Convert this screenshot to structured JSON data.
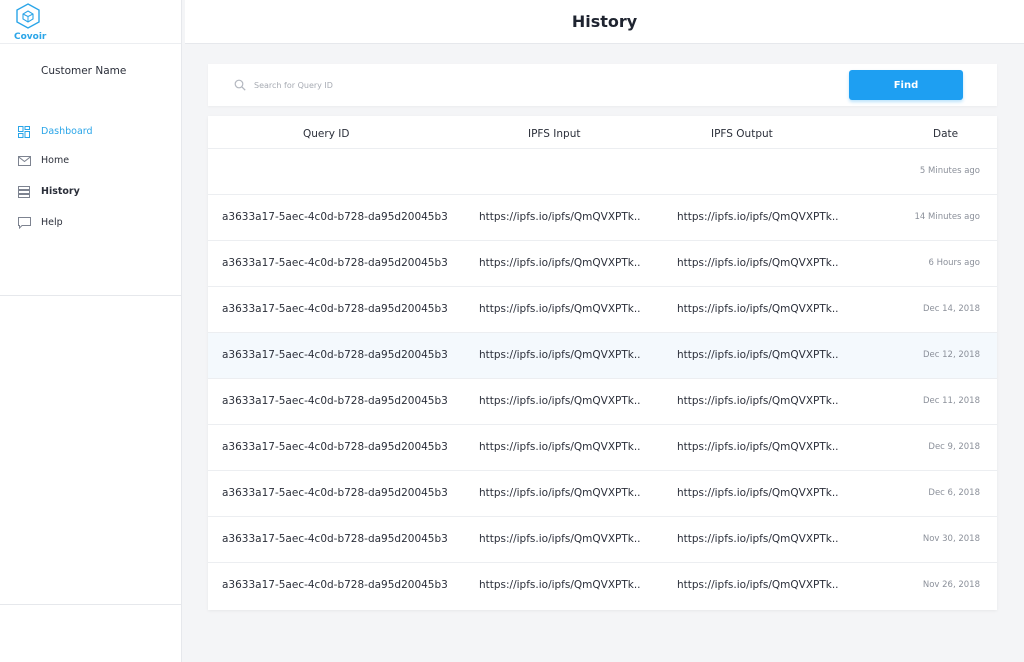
{
  "brand": {
    "name": "Covoir",
    "logo_icon": "cube-hexagon-icon"
  },
  "user": {
    "name": "Customer Name"
  },
  "nav": [
    {
      "label": "Dashboard",
      "icon": "dashboard-grid-icon",
      "active": true
    },
    {
      "label": "Home",
      "icon": "mail-icon",
      "active": false
    },
    {
      "label": "History",
      "icon": "list-icon",
      "active": false
    },
    {
      "label": "Help",
      "icon": "chat-bubble-icon",
      "active": false
    }
  ],
  "header": {
    "title": "History"
  },
  "search": {
    "placeholder": "Search for Query ID",
    "value": "",
    "button_label": "Find"
  },
  "table": {
    "columns": [
      "Query ID",
      "IPFS Input",
      "IPFS Output",
      "Date"
    ],
    "rows": [
      {
        "query_id": "",
        "ipfs_input": "",
        "ipfs_output": "",
        "date": "5 Minutes ago"
      },
      {
        "query_id": "a3633a17-5aec-4c0d-b728-da95d20045b3",
        "ipfs_input": "https://ipfs.io/ipfs/QmQVXPTk..",
        "ipfs_output": "https://ipfs.io/ipfs/QmQVXPTk..",
        "date": "14 Minutes ago"
      },
      {
        "query_id": "a3633a17-5aec-4c0d-b728-da95d20045b3",
        "ipfs_input": "https://ipfs.io/ipfs/QmQVXPTk..",
        "ipfs_output": "https://ipfs.io/ipfs/QmQVXPTk..",
        "date": "6 Hours ago"
      },
      {
        "query_id": "a3633a17-5aec-4c0d-b728-da95d20045b3",
        "ipfs_input": "https://ipfs.io/ipfs/QmQVXPTk..",
        "ipfs_output": "https://ipfs.io/ipfs/QmQVXPTk..",
        "date": "Dec 14, 2018"
      },
      {
        "query_id": "a3633a17-5aec-4c0d-b728-da95d20045b3",
        "ipfs_input": "https://ipfs.io/ipfs/QmQVXPTk..",
        "ipfs_output": "https://ipfs.io/ipfs/QmQVXPTk..",
        "date": "Dec 12, 2018"
      },
      {
        "query_id": "a3633a17-5aec-4c0d-b728-da95d20045b3",
        "ipfs_input": "https://ipfs.io/ipfs/QmQVXPTk..",
        "ipfs_output": "https://ipfs.io/ipfs/QmQVXPTk..",
        "date": "Dec 11, 2018"
      },
      {
        "query_id": "a3633a17-5aec-4c0d-b728-da95d20045b3",
        "ipfs_input": "https://ipfs.io/ipfs/QmQVXPTk..",
        "ipfs_output": "https://ipfs.io/ipfs/QmQVXPTk..",
        "date": "Dec 9, 2018"
      },
      {
        "query_id": "a3633a17-5aec-4c0d-b728-da95d20045b3",
        "ipfs_input": "https://ipfs.io/ipfs/QmQVXPTk..",
        "ipfs_output": "https://ipfs.io/ipfs/QmQVXPTk..",
        "date": "Dec 6, 2018"
      },
      {
        "query_id": "a3633a17-5aec-4c0d-b728-da95d20045b3",
        "ipfs_input": "https://ipfs.io/ipfs/QmQVXPTk..",
        "ipfs_output": "https://ipfs.io/ipfs/QmQVXPTk..",
        "date": "Nov 30, 2018"
      },
      {
        "query_id": "a3633a17-5aec-4c0d-b728-da95d20045b3",
        "ipfs_input": "https://ipfs.io/ipfs/QmQVXPTk..",
        "ipfs_output": "https://ipfs.io/ipfs/QmQVXPTk..",
        "date": "Nov 26, 2018"
      }
    ]
  },
  "colors": {
    "accent": "#1e9ff2",
    "brand": "#2aa5e8",
    "row_highlight": "#f4f9fd",
    "background": "#f4f5f7"
  }
}
